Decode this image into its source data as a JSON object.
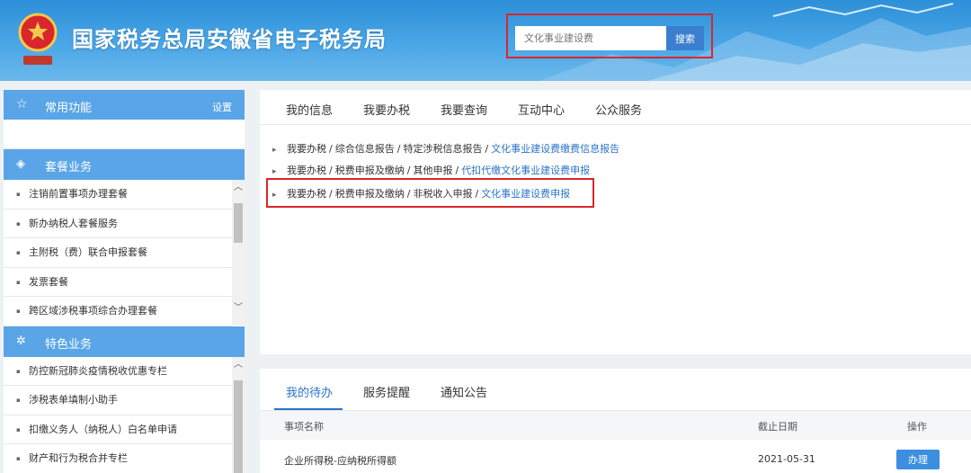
{
  "header": {
    "site_title": "国家税务总局安徽省电子税务局",
    "search_placeholder": "文化事业建设费",
    "search_button": "搜索"
  },
  "sidebar": {
    "common": {
      "title": "常用功能",
      "settings": "设置"
    },
    "package_group": {
      "title": "套餐业务",
      "items": [
        "注销前置事项办理套餐",
        "新办纳税人套餐服务",
        "主附税（费）联合申报套餐",
        "发票套餐",
        "跨区域涉税事项综合办理套餐"
      ]
    },
    "feature_group": {
      "title": "特色业务",
      "items": [
        "防控新冠肺炎疫情税收优惠专栏",
        "涉税表单填制小助手",
        "扣缴义务人（纳税人）白名单申请",
        "财产和行为税合并专栏"
      ]
    }
  },
  "main": {
    "tabs": [
      "我的信息",
      "我要办税",
      "我要查询",
      "互动中心",
      "公众服务"
    ],
    "results": [
      {
        "path": [
          "我要办税",
          "综合信息报告",
          "特定涉税信息报告"
        ],
        "link": "文化事业建设费缴费信息报告"
      },
      {
        "path": [
          "我要办税",
          "税费申报及缴纳",
          "其他申报"
        ],
        "link": "代扣代缴文化事业建设费申报"
      },
      {
        "path": [
          "我要办税",
          "税费申报及缴纳",
          "非税收入申报"
        ],
        "link": "文化事业建设费申报"
      }
    ]
  },
  "todo": {
    "tabs": [
      "我的待办",
      "服务提醒",
      "通知公告"
    ],
    "columns": {
      "name": "事项名称",
      "deadline": "截止日期",
      "action": "操作"
    },
    "rows": [
      {
        "name": "企业所得税-应纳税所得额",
        "deadline": "2021-05-31",
        "action": "办理"
      }
    ]
  },
  "colors": {
    "header_blue": "#3f9de2",
    "sidebar_blue": "#5aa5e8",
    "link_blue": "#2b74c7",
    "highlight_red": "#d9262c"
  }
}
